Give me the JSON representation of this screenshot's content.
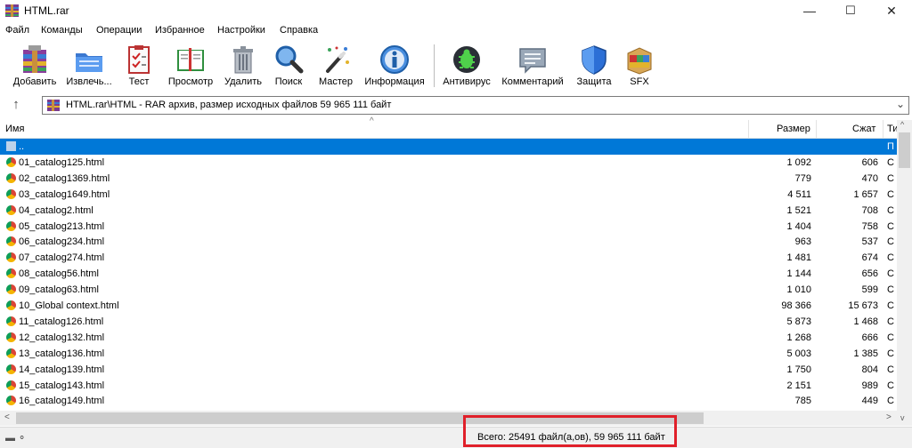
{
  "window": {
    "title": "HTML.rar",
    "controls": {
      "minimize": "—",
      "maximize": "☐",
      "close": "✕"
    }
  },
  "menu": [
    "Файл",
    "Команды",
    "Операции",
    "Избранное",
    "Настройки",
    "Справка"
  ],
  "toolbar": [
    {
      "label": "Добавить",
      "icon": "add-archive-icon"
    },
    {
      "label": "Извлечь...",
      "icon": "extract-folder-icon"
    },
    {
      "label": "Тест",
      "icon": "test-checklist-icon"
    },
    {
      "label": "Просмотр",
      "icon": "view-book-icon"
    },
    {
      "label": "Удалить",
      "icon": "trash-icon"
    },
    {
      "label": "Поиск",
      "icon": "magnifier-icon"
    },
    {
      "label": "Мастер",
      "icon": "wizard-wand-icon"
    },
    {
      "label": "Информация",
      "icon": "info-icon"
    },
    {
      "label": "Антивирус",
      "icon": "antivirus-bug-icon"
    },
    {
      "label": "Комментарий",
      "icon": "comment-icon"
    },
    {
      "label": "Защита",
      "icon": "shield-icon"
    },
    {
      "label": "SFX",
      "icon": "sfx-box-icon"
    }
  ],
  "address": {
    "up_arrow": "↑",
    "path": "HTML.rar\\HTML - RAR архив, размер исходных файлов 59 965 111 байт",
    "dropdown": "⌄"
  },
  "columns": {
    "name": "Имя",
    "size": "Размер",
    "packed": "Сжат",
    "type": "Ти",
    "sort_indicator": "^"
  },
  "files": [
    {
      "name": "..",
      "size": "",
      "packed": "",
      "type": "П",
      "selected": true
    },
    {
      "name": "01_catalog125.html",
      "size": "1 092",
      "packed": "606",
      "type": "С"
    },
    {
      "name": "02_catalog1369.html",
      "size": "779",
      "packed": "470",
      "type": "С"
    },
    {
      "name": "03_catalog1649.html",
      "size": "4 511",
      "packed": "1 657",
      "type": "С"
    },
    {
      "name": "04_catalog2.html",
      "size": "1 521",
      "packed": "708",
      "type": "С"
    },
    {
      "name": "05_catalog213.html",
      "size": "1 404",
      "packed": "758",
      "type": "С"
    },
    {
      "name": "06_catalog234.html",
      "size": "963",
      "packed": "537",
      "type": "С"
    },
    {
      "name": "07_catalog274.html",
      "size": "1 481",
      "packed": "674",
      "type": "С"
    },
    {
      "name": "08_catalog56.html",
      "size": "1 144",
      "packed": "656",
      "type": "С"
    },
    {
      "name": "09_catalog63.html",
      "size": "1 010",
      "packed": "599",
      "type": "С"
    },
    {
      "name": "10_Global context.html",
      "size": "98 366",
      "packed": "15 673",
      "type": "С"
    },
    {
      "name": "11_catalog126.html",
      "size": "5 873",
      "packed": "1 468",
      "type": "С"
    },
    {
      "name": "12_catalog132.html",
      "size": "1 268",
      "packed": "666",
      "type": "С"
    },
    {
      "name": "13_catalog136.html",
      "size": "5 003",
      "packed": "1 385",
      "type": "С"
    },
    {
      "name": "14_catalog139.html",
      "size": "1 750",
      "packed": "804",
      "type": "С"
    },
    {
      "name": "15_catalog143.html",
      "size": "2 151",
      "packed": "989",
      "type": "С"
    },
    {
      "name": "16_catalog149.html",
      "size": "785",
      "packed": "449",
      "type": "С"
    }
  ],
  "scroll": {
    "left": "<",
    "right": ">",
    "up": "^",
    "down": "v"
  },
  "status": {
    "total": "Всего: 25491 файл(а,ов), 59 965 111 байт",
    "icons": "▬ ⚬"
  },
  "colors": {
    "selection": "#0078d7",
    "highlight": "#e0202a"
  }
}
